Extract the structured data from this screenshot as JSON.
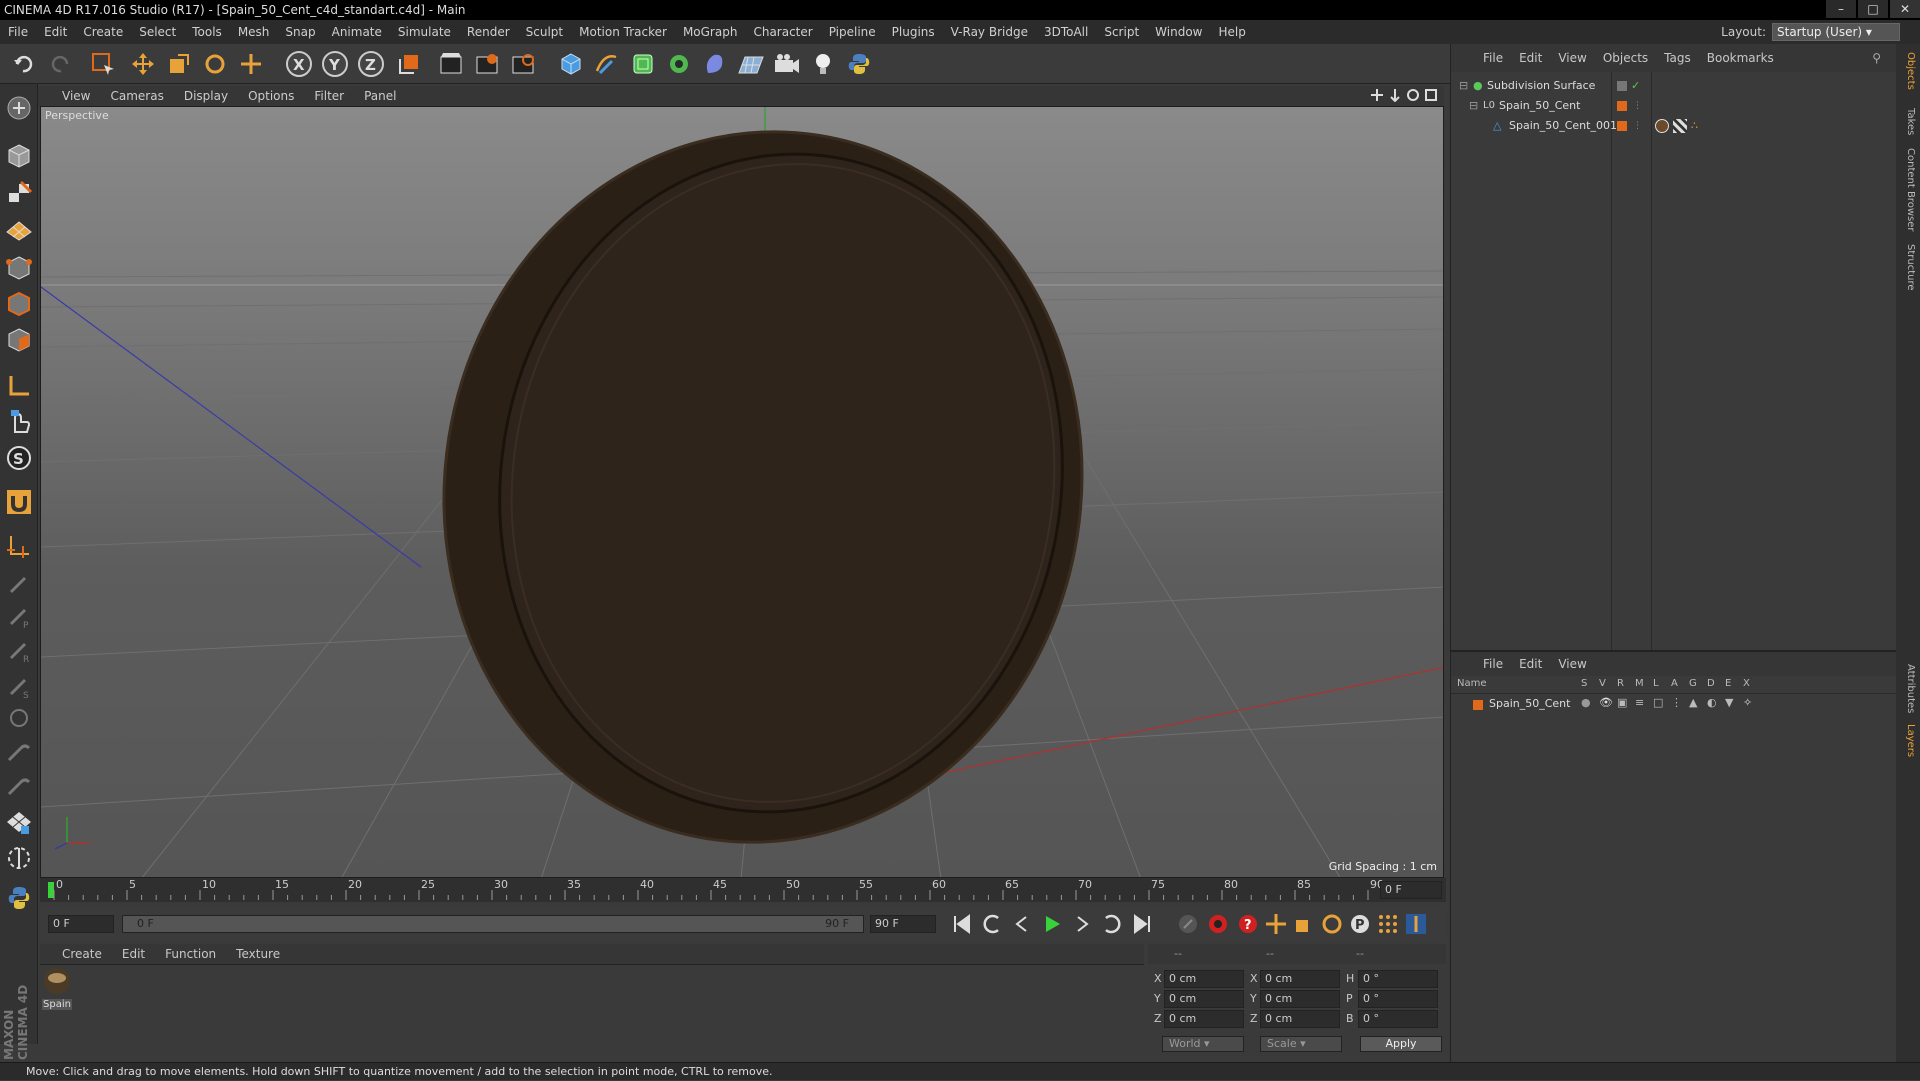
{
  "title": "CINEMA 4D R17.016 Studio (R17) - [Spain_50_Cent_c4d_standart.c4d] - Main",
  "menu": [
    "File",
    "Edit",
    "Create",
    "Select",
    "Tools",
    "Mesh",
    "Snap",
    "Animate",
    "Simulate",
    "Render",
    "Sculpt",
    "Motion Tracker",
    "MoGraph",
    "Character",
    "Pipeline",
    "Plugins",
    "V-Ray Bridge",
    "3DToAll",
    "Script",
    "Window",
    "Help"
  ],
  "layout_label": "Layout:",
  "layout_value": "Startup (User)",
  "viewport": {
    "menu": [
      "View",
      "Cameras",
      "Display",
      "Options",
      "Filter",
      "Panel"
    ],
    "label": "Perspective",
    "grid_spacing": "Grid Spacing : 1 cm"
  },
  "timeline": {
    "ticks": [
      "0",
      "5",
      "10",
      "15",
      "20",
      "25",
      "30",
      "35",
      "40",
      "45",
      "50",
      "55",
      "60",
      "65",
      "70",
      "75",
      "80",
      "85",
      "90"
    ],
    "current_frame": "0 F",
    "start_frame": "0 F",
    "range_start": "0 F",
    "range_end": "90 F",
    "end_frame": "90 F"
  },
  "material_menu": [
    "Create",
    "Edit",
    "Function",
    "Texture"
  ],
  "material_name": "Spain",
  "coords": {
    "header": [
      "--",
      "--",
      "--"
    ],
    "rows": [
      {
        "a": "X",
        "av": "0 cm",
        "b": "X",
        "bv": "0 cm",
        "c": "H",
        "cv": "0 °"
      },
      {
        "a": "Y",
        "av": "0 cm",
        "b": "Y",
        "bv": "0 cm",
        "c": "P",
        "cv": "0 °"
      },
      {
        "a": "Z",
        "av": "0 cm",
        "b": "Z",
        "bv": "0 cm",
        "c": "B",
        "cv": "0 °"
      }
    ],
    "world": "World",
    "scale": "Scale",
    "apply": "Apply"
  },
  "status": "Move: Click and drag to move elements. Hold down SHIFT to quantize movement / add to the selection in point mode, CTRL to remove.",
  "objects_menu": [
    "File",
    "Edit",
    "View",
    "Objects",
    "Tags",
    "Bookmarks"
  ],
  "objects": [
    {
      "name": "Subdivision Surface"
    },
    {
      "name": "Spain_50_Cent"
    },
    {
      "name": "Spain_50_Cent_001"
    }
  ],
  "layers_menu": [
    "File",
    "Edit",
    "View"
  ],
  "layers_columns": [
    "Name",
    "S",
    "V",
    "R",
    "M",
    "L",
    "A",
    "G",
    "D",
    "E",
    "X"
  ],
  "layer_row": "Spain_50_Cent",
  "side_tabs": [
    "Objects",
    "Takes",
    "Content Browser",
    "Structure",
    "Attributes",
    "Layers"
  ],
  "maxon": "MAXON CINEMA 4D",
  "colors": {
    "accent": "#e06a1a",
    "coin": "#2e241b",
    "green": "#5bc85b"
  }
}
